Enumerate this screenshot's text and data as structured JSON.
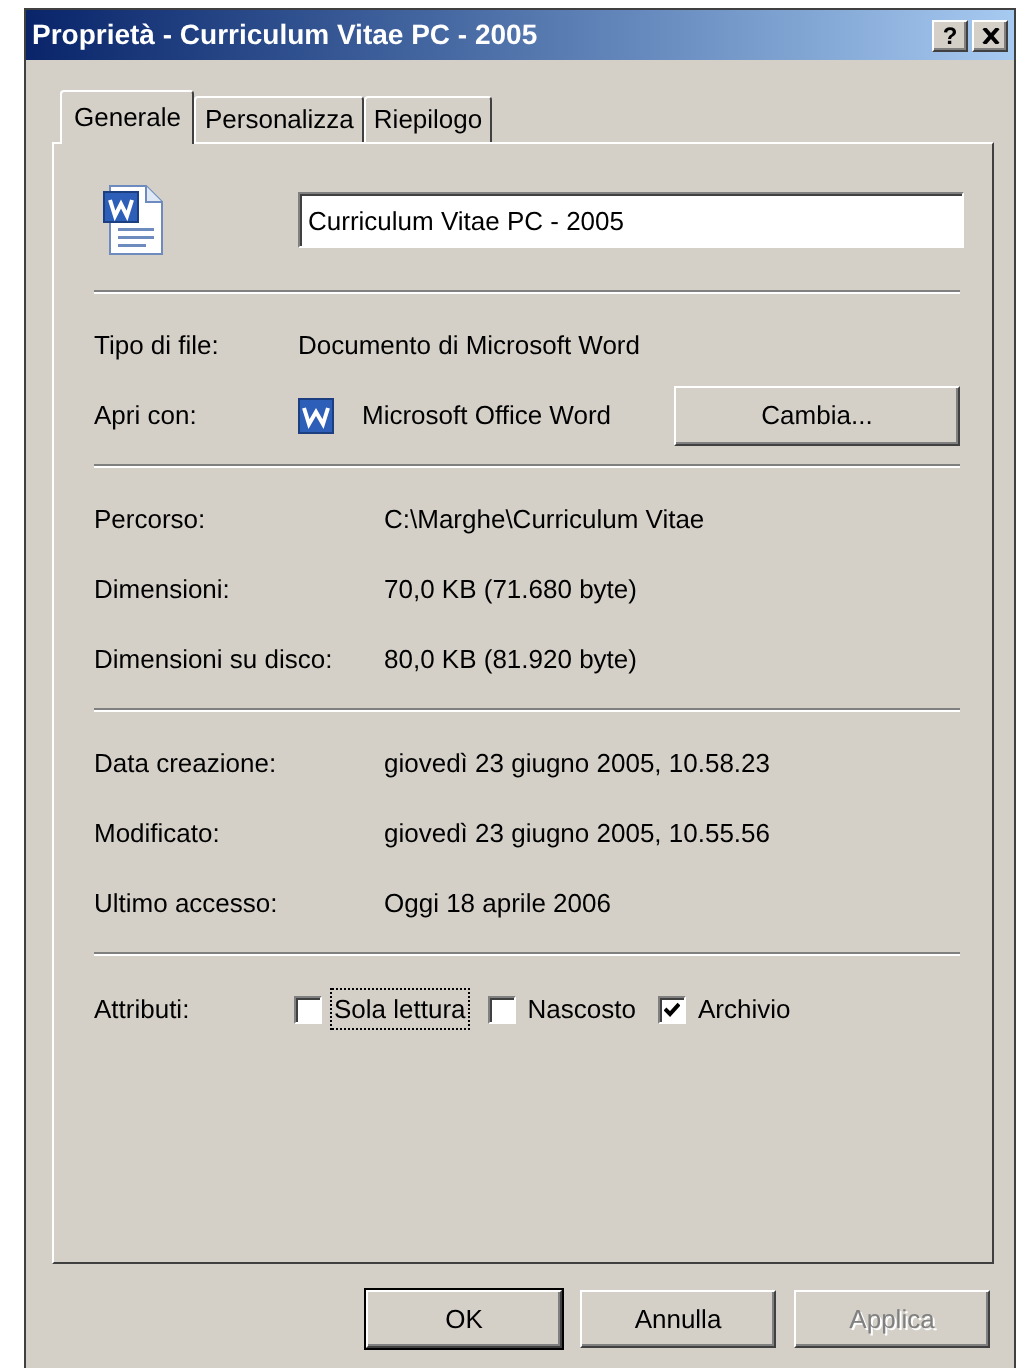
{
  "window": {
    "title": "Proprietà - Curriculum Vitae PC - 2005",
    "help_button": "?"
  },
  "tabs": [
    {
      "label": "Generale",
      "selected": true
    },
    {
      "label": "Personalizza",
      "selected": false
    },
    {
      "label": "Riepilogo",
      "selected": false
    }
  ],
  "file_name": {
    "value": "Curriculum Vitae PC - 2005"
  },
  "info_groups": [
    [
      {
        "kind": "text",
        "label": "Tipo di file:",
        "value": "Documento di Microsoft Word"
      },
      {
        "kind": "app",
        "label": "Apri con:",
        "value": "Microsoft Office Word",
        "button": "Cambia..."
      }
    ],
    [
      {
        "kind": "text",
        "label": "Percorso:",
        "value": "C:\\Marghe\\Curriculum Vitae"
      },
      {
        "kind": "text",
        "label": "Dimensioni:",
        "value": "70,0 KB (71.680 byte)"
      },
      {
        "kind": "text",
        "label": "Dimensioni su disco:",
        "value": "80,0 KB (81.920 byte)"
      }
    ],
    [
      {
        "kind": "text",
        "label": "Data creazione:",
        "value": "giovedì 23 giugno 2005, 10.58.23"
      },
      {
        "kind": "text",
        "label": "Modificato:",
        "value": "giovedì 23 giugno 2005, 10.55.56"
      },
      {
        "kind": "text",
        "label": "Ultimo accesso:",
        "value": "Oggi 18 aprile 2006"
      }
    ]
  ],
  "attributes": {
    "label": "Attributi:",
    "items": [
      {
        "label": "Sola lettura",
        "checked": false,
        "focused": true
      },
      {
        "label": "Nascosto",
        "checked": false,
        "focused": false
      },
      {
        "label": "Archivio",
        "checked": true,
        "focused": false
      }
    ]
  },
  "buttons": [
    {
      "label": "OK",
      "default": true,
      "disabled": false
    },
    {
      "label": "Annulla",
      "default": false,
      "disabled": false
    },
    {
      "label": "Applica",
      "default": false,
      "disabled": true
    }
  ]
}
